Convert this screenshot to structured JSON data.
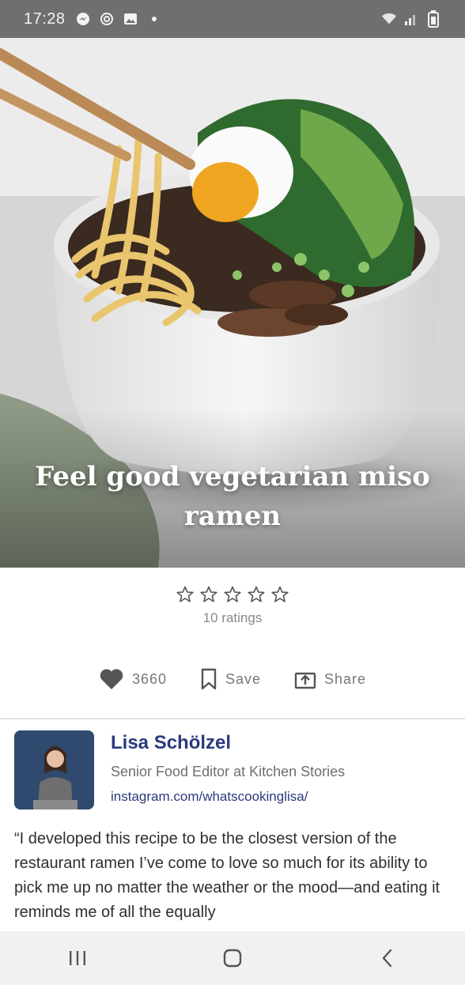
{
  "status_bar": {
    "time": "17:28",
    "notification_icons": [
      "messenger-icon",
      "threads-icon",
      "gallery-icon",
      "dot-icon"
    ],
    "system_icons": [
      "wifi-icon",
      "signal-icon",
      "battery-icon"
    ]
  },
  "recipe": {
    "title": "Feel good vegetarian miso ramen",
    "rating": {
      "stars_filled": 0,
      "stars_total": 5,
      "count_label": "10 ratings"
    },
    "actions": {
      "likes": "3660",
      "save_label": "Save",
      "share_label": "Share"
    }
  },
  "author": {
    "name": "Lisa Schölzel",
    "role": "Senior Food Editor at Kitchen Stories",
    "link": "instagram.com/whatscookinglisa/"
  },
  "description": "“I developed this recipe to be the closest version of the restaurant ramen I’ve come to love so much for its ability to pick me up no matter the weather or the mood—and eating it reminds me of all the equally",
  "colors": {
    "accent": "#2c3a7c",
    "muted": "#777777"
  }
}
